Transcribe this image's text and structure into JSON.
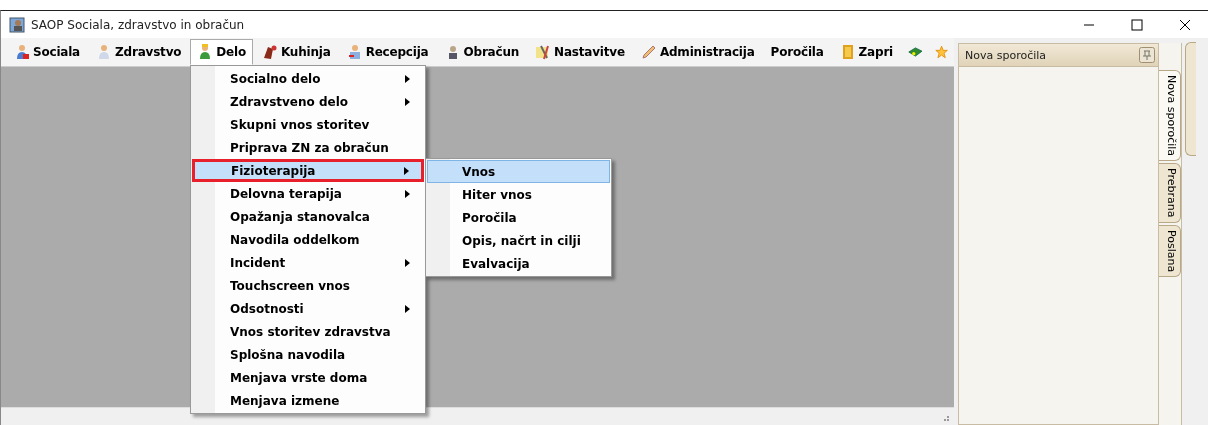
{
  "window": {
    "title": "SAOP Sociala, zdravstvo in obračun"
  },
  "menu_bar": [
    {
      "label": "Sociala",
      "selected": false
    },
    {
      "label": "Zdravstvo",
      "selected": false
    },
    {
      "label": "Delo",
      "selected": true
    },
    {
      "label": "Kuhinja",
      "selected": false
    },
    {
      "label": "Recepcija",
      "selected": false
    },
    {
      "label": "Obračun",
      "selected": false
    },
    {
      "label": "Nastavitve",
      "selected": false
    },
    {
      "label": "Administracija",
      "selected": false
    },
    {
      "label": "Poročila",
      "selected": false
    },
    {
      "label": "Zapri",
      "selected": false
    }
  ],
  "dropdown": [
    {
      "label": "Socialno delo",
      "submenu": true,
      "selected": false
    },
    {
      "label": "Zdravstveno delo",
      "submenu": true,
      "selected": false
    },
    {
      "label": "Skupni vnos storitev",
      "submenu": false,
      "selected": false
    },
    {
      "label": "Priprava ZN za obračun",
      "submenu": false,
      "selected": false
    },
    {
      "label": "Fizioterapija",
      "submenu": true,
      "selected": true
    },
    {
      "label": "Delovna terapija",
      "submenu": true,
      "selected": false
    },
    {
      "label": "Opažanja stanovalca",
      "submenu": false,
      "selected": false
    },
    {
      "label": "Navodila oddelkom",
      "submenu": false,
      "selected": false
    },
    {
      "label": "Incident",
      "submenu": true,
      "selected": false
    },
    {
      "label": "Touchscreen vnos",
      "submenu": false,
      "selected": false
    },
    {
      "label": "Odsotnosti",
      "submenu": true,
      "selected": false
    },
    {
      "label": "Vnos storitev zdravstva",
      "submenu": false,
      "selected": false
    },
    {
      "label": "Splošna navodila",
      "submenu": false,
      "selected": false
    },
    {
      "label": "Menjava vrste doma",
      "submenu": false,
      "selected": false
    },
    {
      "label": "Menjava izmene",
      "submenu": false,
      "selected": false
    }
  ],
  "submenu": [
    {
      "label": "Vnos",
      "selected": true
    },
    {
      "label": "Hiter vnos",
      "selected": false
    },
    {
      "label": "Poročila",
      "selected": false
    },
    {
      "label": "Opis, načrt in cilji",
      "selected": false
    },
    {
      "label": "Evalvacija",
      "selected": false
    }
  ],
  "side_panel": {
    "title": "Nova sporočila",
    "tabs": [
      {
        "label": "Nova sporočila",
        "selected": true
      },
      {
        "label": "Prebrana",
        "selected": false
      },
      {
        "label": "Poslana",
        "selected": false
      }
    ]
  }
}
